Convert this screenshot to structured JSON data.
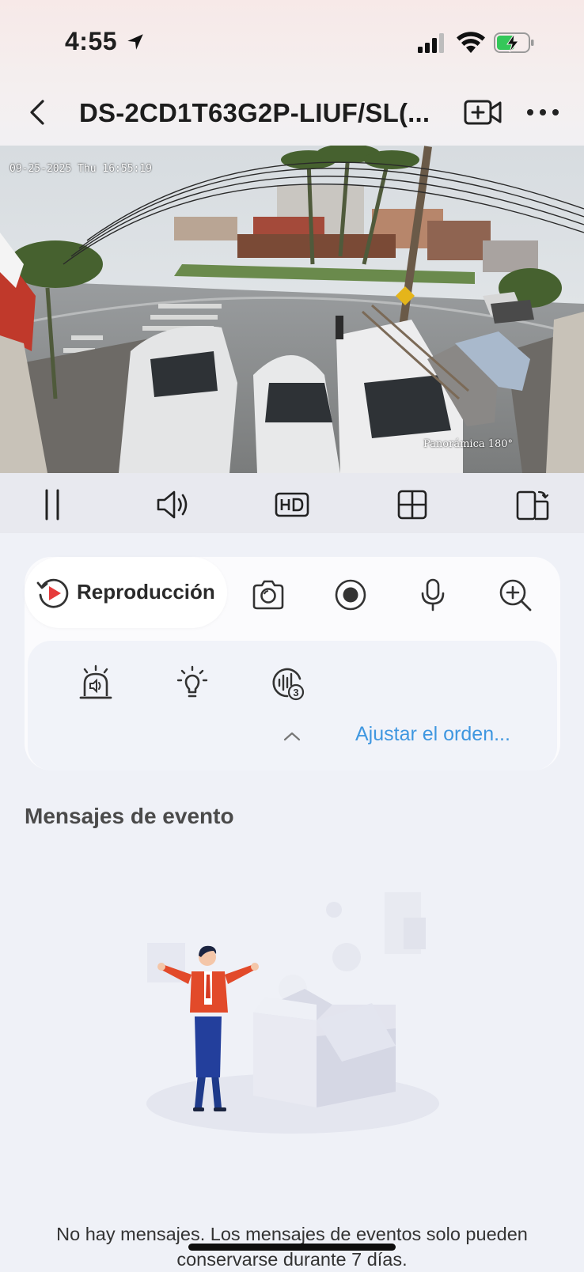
{
  "status_bar": {
    "time": "4:55",
    "icons": [
      "location-arrow-icon",
      "cellular-signal-icon",
      "wifi-icon",
      "battery-charging-icon"
    ]
  },
  "nav": {
    "title": "DS-2CD1T63G2P-LIUF/SL(...",
    "icons": [
      "back-icon",
      "camera-add-icon",
      "more-icon"
    ]
  },
  "video": {
    "osd_timestamp": "09-25-2025 Thu 16:55:19",
    "osd_label": "Panorámica 180°"
  },
  "controls": [
    "pause-icon",
    "speaker-icon",
    "hd-icon",
    "grid-icon",
    "rotate-screen-icon"
  ],
  "panel": {
    "playback_label": "Reproducción",
    "quick_icons": [
      "camera-snapshot-icon",
      "record-icon",
      "microphone-icon",
      "zoom-in-icon"
    ],
    "sub_icons": [
      "siren-alarm-icon",
      "light-bulb-icon",
      "audio-alarm-icon"
    ],
    "adjust_label": "Ajustar el orden..."
  },
  "events": {
    "title": "Mensajes de evento",
    "empty_message": "No hay mensajes. Los mensajes de eventos solo pueden conservarse durante 7 días."
  },
  "colors": {
    "accent_blue": "#3f97e0",
    "record_red": "#e63b3b",
    "battery_green": "#34c759"
  }
}
